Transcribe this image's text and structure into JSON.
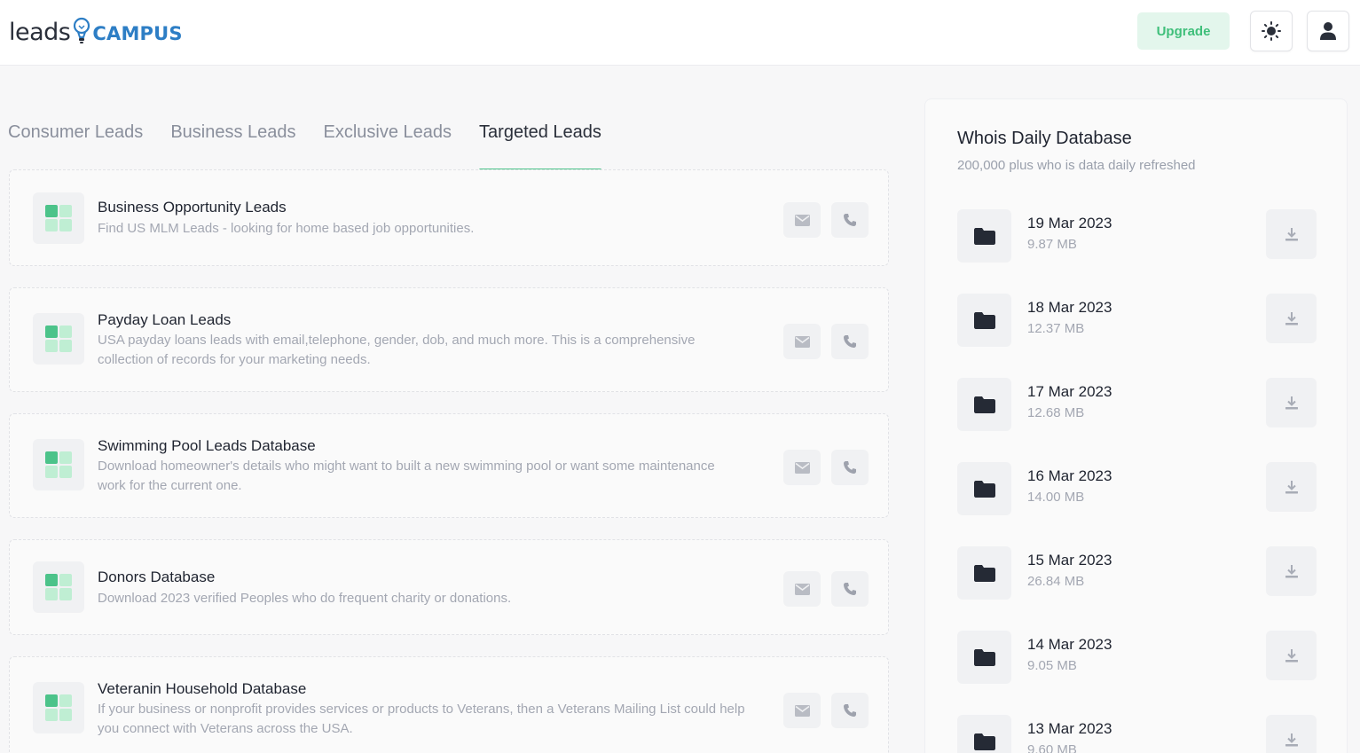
{
  "header": {
    "logo_text_left": "leads",
    "logo_text_right": "CAMPUS",
    "upgrade_label": "Upgrade",
    "theme_icon": "sun-icon",
    "user_icon": "user-icon"
  },
  "tabs": [
    {
      "label": "Consumer Leads",
      "active": false
    },
    {
      "label": "Business Leads",
      "active": false
    },
    {
      "label": "Exclusive Leads",
      "active": false
    },
    {
      "label": "Targeted Leads",
      "active": true
    }
  ],
  "leads": [
    {
      "title": "Business Opportunity Leads",
      "description": "Find US MLM Leads - looking for home based job opportunities."
    },
    {
      "title": "Payday Loan Leads",
      "description": "USA payday loans leads with email,telephone, gender, dob, and much more. This is a comprehensive collection of records for your marketing needs."
    },
    {
      "title": "Swimming Pool Leads Database",
      "description": "Download homeowner's details who might want to built a new swimming pool or want some maintenance work for the current one."
    },
    {
      "title": "Donors Database",
      "description": "Download 2023 verified Peoples who do frequent charity or donations."
    },
    {
      "title": "Veteranin Household Database",
      "description": "If your business or nonprofit provides services or products to Veterans, then a Veterans Mailing List could help you connect with Veterans across the USA."
    }
  ],
  "whois": {
    "title": "Whois Daily Database",
    "subtitle": "200,000 plus who is data daily refreshed",
    "files": [
      {
        "date": "19 Mar 2023",
        "size": "9.87 MB"
      },
      {
        "date": "18 Mar 2023",
        "size": "12.37 MB"
      },
      {
        "date": "17 Mar 2023",
        "size": "12.68 MB"
      },
      {
        "date": "16 Mar 2023",
        "size": "14.00 MB"
      },
      {
        "date": "15 Mar 2023",
        "size": "26.84 MB"
      },
      {
        "date": "14 Mar 2023",
        "size": "9.05 MB"
      },
      {
        "date": "13 Mar 2023",
        "size": "9.60 MB"
      }
    ]
  },
  "colors": {
    "accent": "#4cc38a",
    "accent_light": "#bfeed3",
    "brand_blue": "#2d7ec5",
    "upgrade_bg": "#e3f6ec"
  }
}
